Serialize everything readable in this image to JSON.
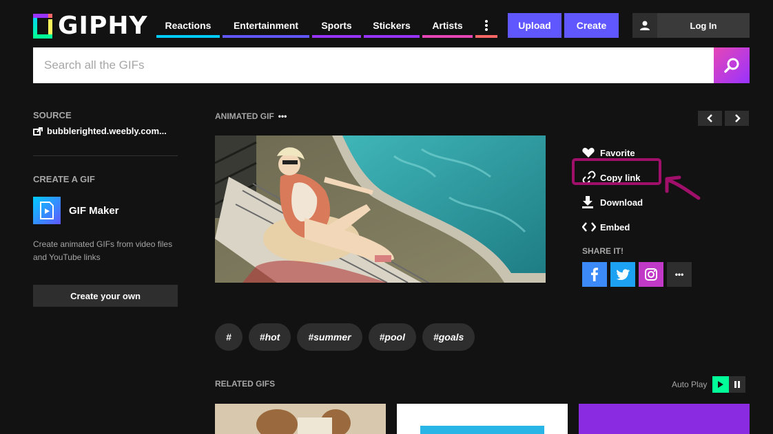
{
  "brand": {
    "name": "GIPHY"
  },
  "nav": {
    "items": [
      {
        "label": "Reactions",
        "color": "#00ccff"
      },
      {
        "label": "Entertainment",
        "color": "#6157ff"
      },
      {
        "label": "Sports",
        "color": "#9933ff"
      },
      {
        "label": "Stickers",
        "color": "#9933ff"
      },
      {
        "label": "Artists",
        "color": "#e646b6"
      }
    ],
    "more_color": "#ff6666",
    "upload_label": "Upload",
    "create_label": "Create",
    "login_label": "Log In"
  },
  "search": {
    "placeholder": "Search all the GIFs"
  },
  "sidebar": {
    "source_label": "SOURCE",
    "source_link": "bubblerighted.weebly.com...",
    "create_label": "CREATE A GIF",
    "gif_maker_title": "GIF Maker",
    "gif_maker_desc": "Create animated GIFs from video files and YouTube links",
    "create_own_label": "Create your own"
  },
  "gif": {
    "label": "ANIMATED GIF",
    "more": "•••"
  },
  "actions": {
    "favorite": "Favorite",
    "copy_link": "Copy link",
    "download": "Download",
    "embed": "Embed",
    "share_label": "SHARE IT!",
    "share_more": "•••"
  },
  "tags": [
    "#",
    "#hot",
    "#summer",
    "#pool",
    "#goals"
  ],
  "related": {
    "label": "RELATED GIFS",
    "autoplay_label": "Auto Play"
  },
  "colors": {
    "accent": "#6157ff",
    "highlight": "#a0106a",
    "facebook": "#3b8af7",
    "twitter": "#1da1f2",
    "instagram": "#c03ac7",
    "play": "#00ff99"
  }
}
